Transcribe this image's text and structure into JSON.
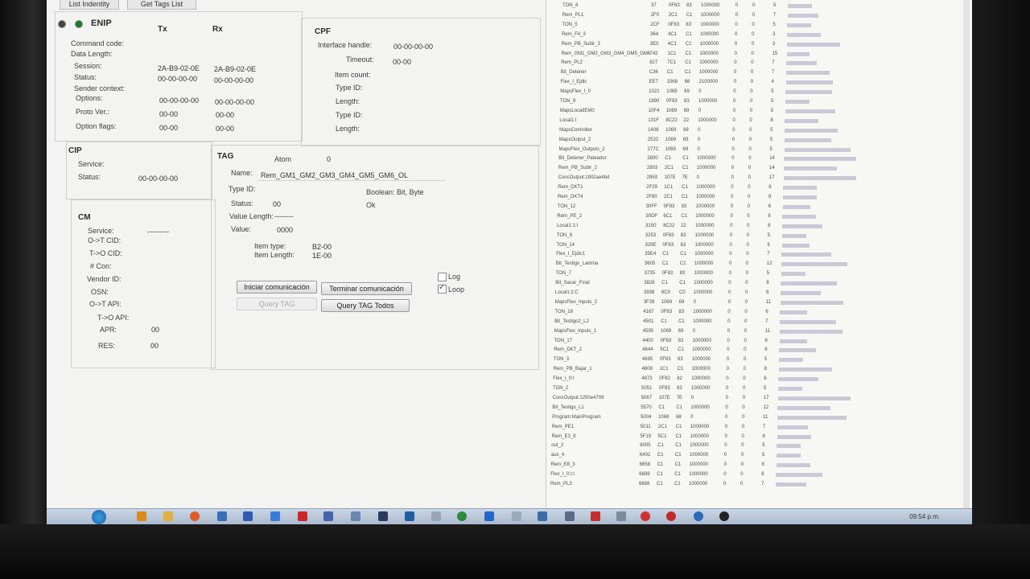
{
  "toolbar": {
    "list_identity": "List Indentity",
    "get_tags": "Get Tags List"
  },
  "enip": {
    "title": "ENIP",
    "tx": "Tx",
    "rx": "Rx",
    "labels": [
      "Command code:",
      "Data Length:",
      "Session:",
      "Status:",
      "Sender context:",
      "Options:",
      "Proto Ver.:",
      "Option flags:"
    ],
    "session_tx": "2A-B9-02-0E",
    "session_rx": "2A-B9-02-0E",
    "status_tx": "00-00-00-00",
    "status_rx": "00-00-00-00",
    "options_tx": "00-00-00-00",
    "options_rx": "00-00-00-00",
    "proto_tx": "00-00",
    "proto_rx": "00-00",
    "flags_tx": "00-00",
    "flags_rx": "00-00"
  },
  "cpf": {
    "title": "CPF",
    "labels": [
      "Interface handle:",
      "Timeout:",
      "Item count:",
      "Type ID:",
      "Length:",
      "Type ID:",
      "Length:"
    ],
    "interface_handle": "00-00-00-00",
    "timeout": "00-00"
  },
  "cip": {
    "title": "CIP",
    "service": "Service:",
    "status": "Status:",
    "status_val": "00-00-00-00"
  },
  "tag": {
    "title": "TAG",
    "atom_label": "Atom",
    "atom_val": "0",
    "name_label": "Name:",
    "name_val": "Rem_GM1_GM2_GM3_GM4_GM5_GM6_OL",
    "typeid_label": "Type ID:",
    "typeid_val": "Boolean: Bit, Byte",
    "status_label": "Status:",
    "status_val": "00",
    "status_text": "Ok",
    "vlen_label": "Value Length:",
    "vlen_val": "--------",
    "value_label": "Value:",
    "value_val": "0000",
    "itemtype_label": "Item type:",
    "itemtype_val": "B2-00",
    "itemlen_label": "Item Length:",
    "itemlen_val": "1E-00"
  },
  "cm": {
    "title": "CM",
    "labels": [
      "Service:",
      "O->T CID:",
      "T->O CID:",
      "# Con:",
      "Vendor ID:",
      "OSN:",
      "O->T API:",
      "T->O API:",
      "APR:",
      "RES:"
    ],
    "service_val": "---------",
    "apr_val": "00",
    "res_val": "00"
  },
  "buttons": {
    "iniciar": "Iniciar comunicación",
    "terminar": "Terminar comunicación",
    "query": "Query TAG",
    "query_todos": "Query TAG Todos",
    "log": "Log",
    "loop": "Loop"
  },
  "tag_list": [
    {
      "name": "TON_4",
      "id": "37",
      "t": "0F83",
      "f": "83",
      "v": "1000000",
      "a": "0",
      "b": "0",
      "n": "5"
    },
    {
      "name": "Rem_PL1",
      "id": "2F0",
      "t": "2C1",
      "f": "C1",
      "v": "1000000",
      "a": "0",
      "b": "0",
      "n": "7"
    },
    {
      "name": "TON_5",
      "id": "2CF",
      "t": "0F83",
      "f": "83",
      "v": "1000000",
      "a": "0",
      "b": "0",
      "n": "5"
    },
    {
      "name": "Rem_F4_3",
      "id": "364",
      "t": "4C1",
      "f": "C1",
      "v": "1000000",
      "a": "0",
      "b": "0",
      "n": "3"
    },
    {
      "name": "Rem_PB_Subir_3",
      "id": "3E0",
      "t": "4C1",
      "f": "C1",
      "v": "1000000",
      "a": "0",
      "b": "0",
      "n": "3"
    },
    {
      "name": "Rem_GM1_GM2_GM3_GM4_GM5_GM6",
      "id": "742",
      "t": "1C1",
      "f": "C1",
      "v": "1000000",
      "a": "0",
      "b": "0",
      "n": "15"
    },
    {
      "name": "Rem_PL2",
      "id": "827",
      "t": "7C1",
      "f": "C1",
      "v": "1000000",
      "a": "0",
      "b": "0",
      "n": "7"
    },
    {
      "name": "Bit_Detener",
      "id": "C36",
      "t": "C1",
      "f": "C1",
      "v": "1000000",
      "a": "0",
      "b": "0",
      "n": "7"
    },
    {
      "name": "Flex_I_Ejdic",
      "id": "EE7",
      "t": "1068",
      "f": "68",
      "v": "2100000",
      "a": "0",
      "b": "0",
      "n": "4"
    },
    {
      "name": "MapsFlex_I_0",
      "id": "1021",
      "t": "1069",
      "f": "69",
      "v": "0",
      "a": "0",
      "b": "0",
      "n": "5"
    },
    {
      "name": "TON_9",
      "id": "1890",
      "t": "0F83",
      "f": "83",
      "v": "1000000",
      "a": "0",
      "b": "0",
      "n": "5"
    },
    {
      "name": "MapsLocalIEM0",
      "id": "10F4",
      "t": "1069",
      "f": "69",
      "v": "0",
      "a": "0",
      "b": "0",
      "n": "5"
    },
    {
      "name": "Local1:I",
      "id": "131F",
      "t": "8C22",
      "f": "22",
      "v": "1000000",
      "a": "0",
      "b": "0",
      "n": "8"
    },
    {
      "name": "MapsController",
      "id": "1408",
      "t": "1069",
      "f": "69",
      "v": "0",
      "a": "0",
      "b": "0",
      "n": "5"
    },
    {
      "name": "MapsOutput_2",
      "id": "2532",
      "t": "1069",
      "f": "69",
      "v": "0",
      "a": "0",
      "b": "0",
      "n": "5"
    },
    {
      "name": "MapsFlex_Outputs_2",
      "id": "277C",
      "t": "1069",
      "f": "69",
      "v": "0",
      "a": "0",
      "b": "0",
      "n": "5"
    },
    {
      "name": "Bit_Detener_Pateador",
      "id": "2800",
      "t": "C1",
      "f": "C1",
      "v": "1000000",
      "a": "0",
      "b": "0",
      "n": "14"
    },
    {
      "name": "Rem_PB_Subir_2",
      "id": "2803",
      "t": "2C1",
      "f": "C1",
      "v": "1000000",
      "a": "0",
      "b": "0",
      "n": "14"
    },
    {
      "name": "ConcOutput:1902ae4bd",
      "id": "2859",
      "t": "107E",
      "f": "7E",
      "v": "0",
      "a": "0",
      "b": "0",
      "n": "17"
    },
    {
      "name": "Rem_DKT1",
      "id": "2F29",
      "t": "1C1",
      "f": "C1",
      "v": "1000000",
      "a": "0",
      "b": "0",
      "n": "8"
    },
    {
      "name": "Rem_DKT4",
      "id": "2F80",
      "t": "2C1",
      "f": "C1",
      "v": "1000000",
      "a": "0",
      "b": "0",
      "n": "8"
    },
    {
      "name": "TON_12",
      "id": "30FF",
      "t": "0F83",
      "f": "83",
      "v": "1000000",
      "a": "0",
      "b": "0",
      "n": "6"
    },
    {
      "name": "Rem_PE_2",
      "id": "30DF",
      "t": "6C1",
      "f": "C1",
      "v": "1000000",
      "a": "0",
      "b": "0",
      "n": "8"
    },
    {
      "name": "Local1:1:I",
      "id": "3150",
      "t": "8C22",
      "f": "22",
      "v": "1000000",
      "a": "0",
      "b": "0",
      "n": "8"
    },
    {
      "name": "TON_8",
      "id": "3253",
      "t": "0F83",
      "f": "83",
      "v": "1000000",
      "a": "0",
      "b": "0",
      "n": "5"
    },
    {
      "name": "TON_14",
      "id": "329E",
      "t": "0F83",
      "f": "83",
      "v": "1000000",
      "a": "0",
      "b": "0",
      "n": "6"
    },
    {
      "name": "Flex_I_Ejdic1",
      "id": "35E4",
      "t": "C1",
      "f": "C1",
      "v": "1000000",
      "a": "0",
      "b": "0",
      "n": "7"
    },
    {
      "name": "Bit_Testigo_Lamina",
      "id": "3605",
      "t": "C1",
      "f": "C1",
      "v": "1000000",
      "a": "0",
      "b": "0",
      "n": "12"
    },
    {
      "name": "TON_7",
      "id": "3735",
      "t": "0F83",
      "f": "83",
      "v": "1000000",
      "a": "0",
      "b": "0",
      "n": "5"
    },
    {
      "name": "Bit_Sacar_Final",
      "id": "3828",
      "t": "C1",
      "f": "C1",
      "v": "1000000",
      "a": "0",
      "b": "0",
      "n": "8"
    },
    {
      "name": "Local1:2:C",
      "id": "3938",
      "t": "8C0",
      "f": "C0",
      "v": "1000000",
      "a": "0",
      "b": "0",
      "n": "8"
    },
    {
      "name": "MapsFlex_Inputs_2",
      "id": "3F28",
      "t": "1069",
      "f": "69",
      "v": "0",
      "a": "0",
      "b": "0",
      "n": "11"
    },
    {
      "name": "TON_18",
      "id": "4167",
      "t": "0F83",
      "f": "83",
      "v": "1000000",
      "a": "0",
      "b": "0",
      "n": "6"
    },
    {
      "name": "Bit_Testigo2_L2",
      "id": "4501",
      "t": "C1",
      "f": "C1",
      "v": "1000000",
      "a": "0",
      "b": "0",
      "n": "7"
    },
    {
      "name": "MapsFlex_Inputs_1",
      "id": "4595",
      "t": "1069",
      "f": "69",
      "v": "0",
      "a": "0",
      "b": "0",
      "n": "11"
    },
    {
      "name": "TON_17",
      "id": "4400",
      "t": "0F83",
      "f": "83",
      "v": "1000000",
      "a": "0",
      "b": "0",
      "n": "6"
    },
    {
      "name": "Rem_DKT_2",
      "id": "4644",
      "t": "5C1",
      "f": "C1",
      "v": "1000000",
      "a": "0",
      "b": "0",
      "n": "8"
    },
    {
      "name": "TON_3",
      "id": "4695",
      "t": "0F83",
      "f": "83",
      "v": "1000000",
      "a": "0",
      "b": "0",
      "n": "5"
    },
    {
      "name": "Rem_PB_Bajar_1",
      "id": "4808",
      "t": "1C1",
      "f": "C1",
      "v": "1000000",
      "a": "0",
      "b": "0",
      "n": "8"
    },
    {
      "name": "Flex_I_0:I",
      "id": "4873",
      "t": "0F82",
      "f": "82",
      "v": "1000000",
      "a": "0",
      "b": "0",
      "n": "6"
    },
    {
      "name": "TON_2",
      "id": "5051",
      "t": "0F83",
      "f": "83",
      "v": "1000000",
      "a": "0",
      "b": "0",
      "n": "5"
    },
    {
      "name": "ConcOutput:1250e4709",
      "id": "5067",
      "t": "107E",
      "f": "7E",
      "v": "0",
      "a": "0",
      "b": "0",
      "n": "17"
    },
    {
      "name": "Bit_Testigo_L1",
      "id": "5570",
      "t": "C1",
      "f": "C1",
      "v": "1000000",
      "a": "0",
      "b": "0",
      "n": "12"
    },
    {
      "name": "Program:MainProgram",
      "id": "5004",
      "t": "1068",
      "f": "68",
      "v": "0",
      "a": "0",
      "b": "0",
      "n": "11"
    },
    {
      "name": "Rem_PE1",
      "id": "5011",
      "t": "2C1",
      "f": "C1",
      "v": "1000000",
      "a": "0",
      "b": "0",
      "n": "7"
    },
    {
      "name": "Rem_E3_8",
      "id": "5F15",
      "t": "5C1",
      "f": "C1",
      "v": "1000000",
      "a": "0",
      "b": "0",
      "n": "8"
    },
    {
      "name": "out_2",
      "id": "6005",
      "t": "C1",
      "f": "C1",
      "v": "1000000",
      "a": "0",
      "b": "0",
      "n": "5"
    },
    {
      "name": "aux_4",
      "id": "6402",
      "t": "C1",
      "f": "C1",
      "v": "1000000",
      "a": "0",
      "b": "0",
      "n": "5"
    },
    {
      "name": "Rem_E8_3",
      "id": "6658",
      "t": "C1",
      "f": "C1",
      "v": "1000000",
      "a": "0",
      "b": "0",
      "n": "8"
    },
    {
      "name": "Flex_I_0:I:I",
      "id": "6689",
      "t": "C1",
      "f": "C1",
      "v": "1000000",
      "a": "0",
      "b": "0",
      "n": "8"
    },
    {
      "name": "Rem_PL3",
      "id": "6698",
      "t": "C1",
      "f": "C1",
      "v": "1000000",
      "a": "0",
      "b": "0",
      "n": "7"
    }
  ],
  "taskbar": {
    "clock": "09:54 p.m."
  }
}
